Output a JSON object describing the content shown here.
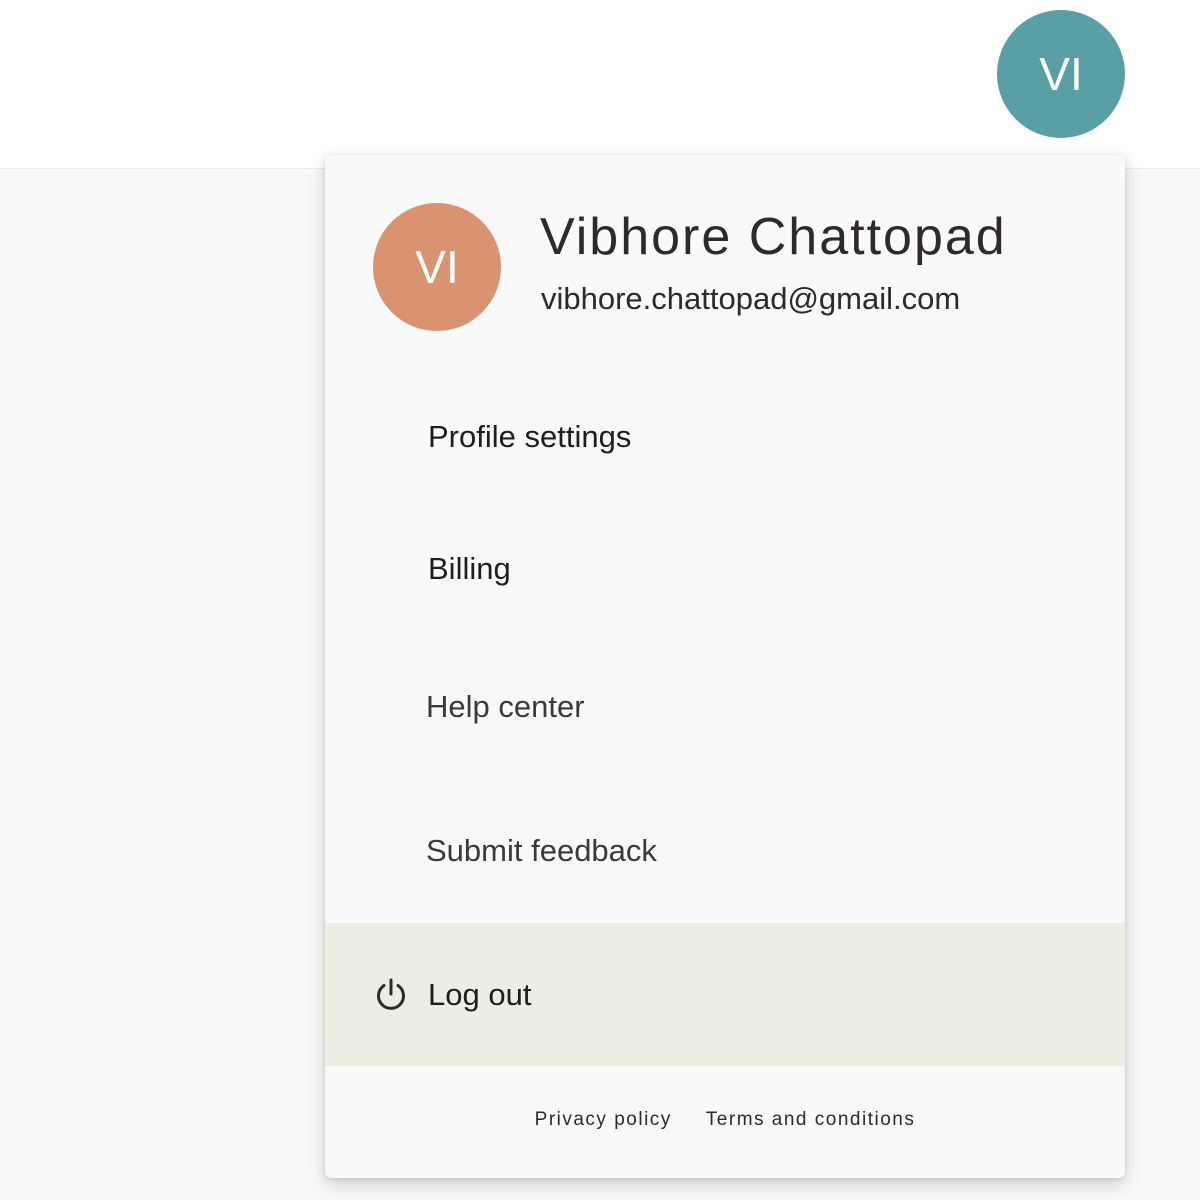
{
  "header": {
    "avatar_initials": "VI",
    "avatar_color": "#5a9fa6"
  },
  "account_menu": {
    "avatar_initials": "VI",
    "avatar_color": "#db9270",
    "user_name": "Vibhore Chattopad",
    "user_email": "vibhore.chattopad@gmail.com",
    "items": [
      {
        "label": "Profile settings"
      },
      {
        "label": "Billing"
      },
      {
        "label": "Help center"
      },
      {
        "label": "Submit feedback"
      }
    ],
    "logout": {
      "label": "Log out",
      "icon": "power-icon",
      "background": "#eeede3"
    },
    "footer": {
      "privacy_label": "Privacy policy",
      "terms_label": "Terms and conditions"
    }
  }
}
